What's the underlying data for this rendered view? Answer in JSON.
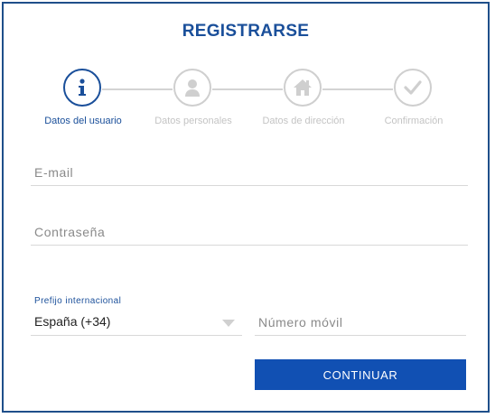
{
  "header": {
    "title": "REGISTRARSE"
  },
  "steps": [
    {
      "label": "Datos del usuario",
      "icon": "info-icon",
      "active": true
    },
    {
      "label": "Datos personales",
      "icon": "user-icon",
      "active": false
    },
    {
      "label": "Datos de dirección",
      "icon": "home-icon",
      "active": false
    },
    {
      "label": "Confirmación",
      "icon": "check-icon",
      "active": false
    }
  ],
  "form": {
    "email_placeholder": "E-mail",
    "password_placeholder": "Contraseña",
    "prefix_label": "Prefijo internacional",
    "prefix_value": "España (+34)",
    "mobile_placeholder": "Número móvil",
    "continue_label": "CONTINUAR"
  },
  "colors": {
    "accent": "#1a4f9a",
    "button": "#1150b3",
    "inactive": "#cfcfcf"
  }
}
